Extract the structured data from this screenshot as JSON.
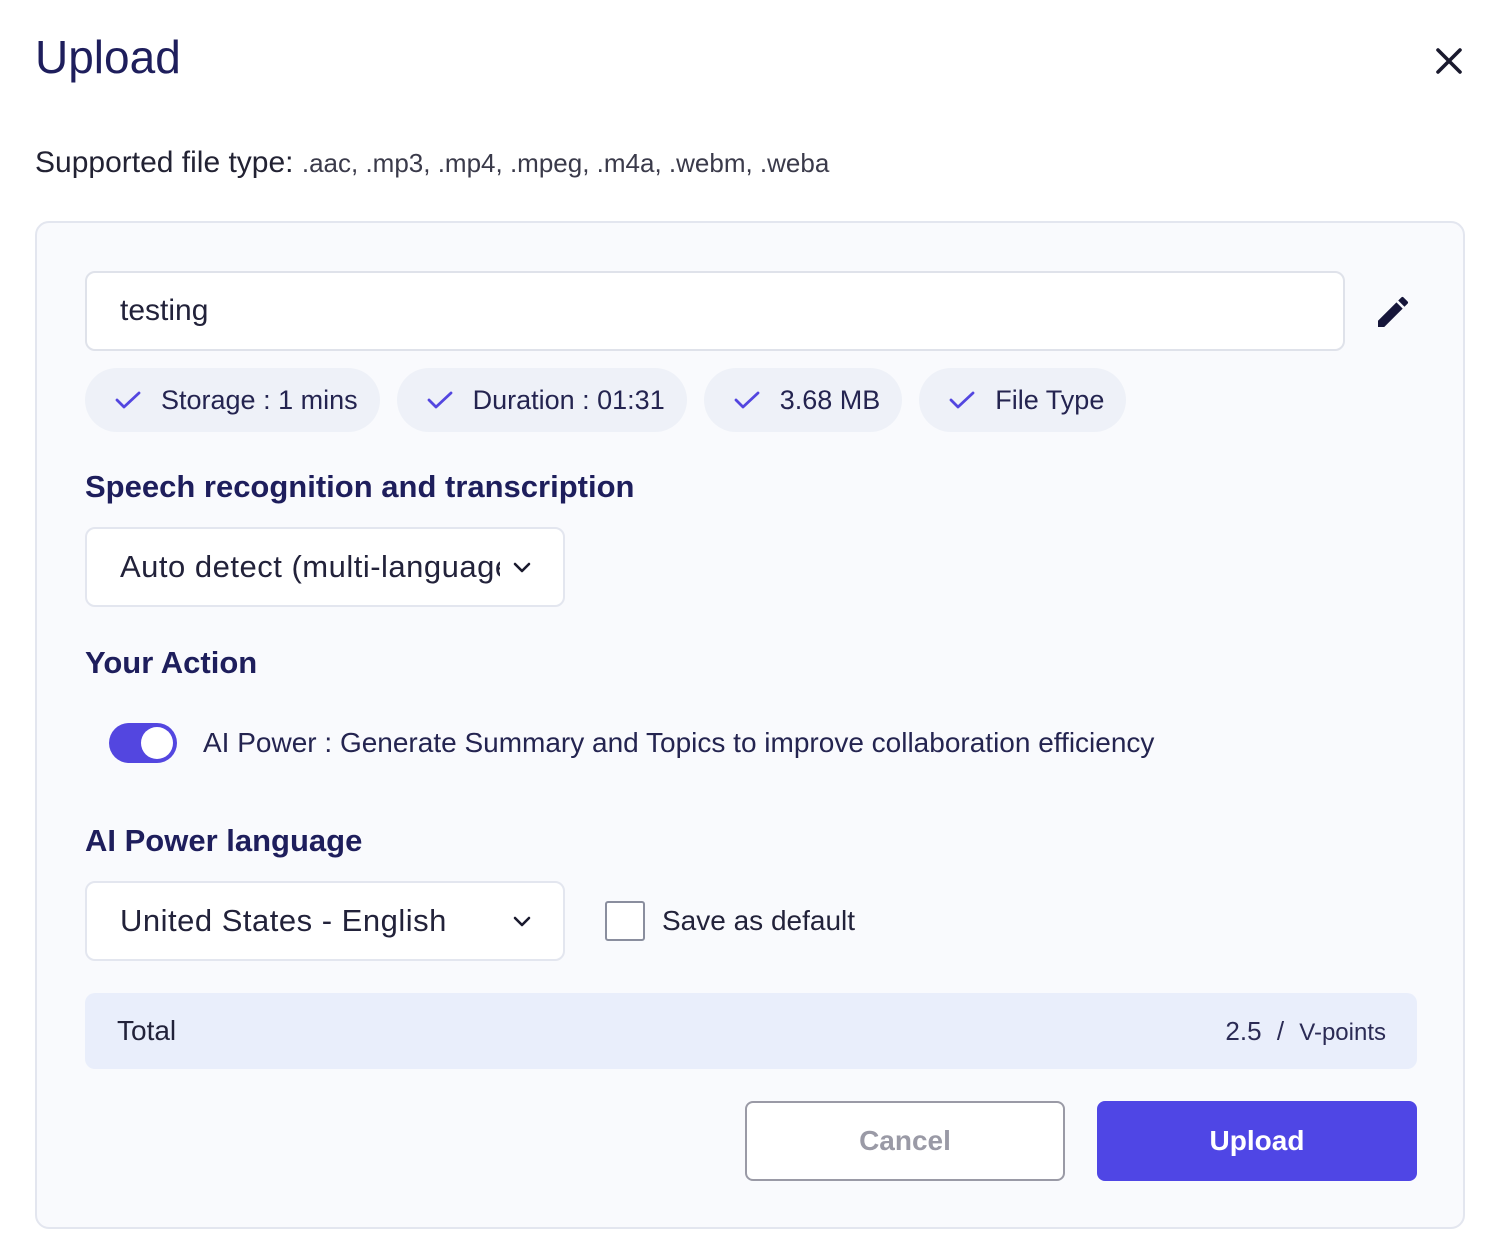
{
  "dialog": {
    "title": "Upload",
    "close_icon": "close-icon"
  },
  "supported": {
    "label": "Supported file type:",
    "types": ".aac, .mp3, .mp4, .mpeg, .m4a, .webm, .weba"
  },
  "file": {
    "name_value": "testing",
    "edit_icon": "pencil-icon"
  },
  "chips": [
    {
      "label": "Storage : 1 mins",
      "icon": "check-icon"
    },
    {
      "label": "Duration : 01:31",
      "icon": "check-icon"
    },
    {
      "label": "3.68 MB",
      "icon": "check-icon"
    },
    {
      "label": "File Type",
      "icon": "check-icon"
    }
  ],
  "speech": {
    "heading": "Speech recognition and transcription",
    "selected": "Auto detect (multi-language)",
    "chevron_icon": "chevron-down-icon"
  },
  "action": {
    "heading": "Your Action",
    "toggle_on": true,
    "toggle_label": "AI Power : Generate Summary and Topics to improve collaboration efficiency"
  },
  "ai_language": {
    "heading": "AI Power language",
    "selected": "United States - English",
    "chevron_icon": "chevron-down-icon",
    "save_default_label": "Save as default",
    "save_default_checked": false
  },
  "total": {
    "label": "Total",
    "amount": "2.5",
    "separator": "/",
    "unit": "V-points"
  },
  "buttons": {
    "cancel_label": "Cancel",
    "upload_label": "Upload"
  },
  "colors": {
    "accent": "#4f46e5",
    "title": "#1e1e5c",
    "panel_bg": "#f9fafd",
    "total_bg": "#e9eefb"
  }
}
